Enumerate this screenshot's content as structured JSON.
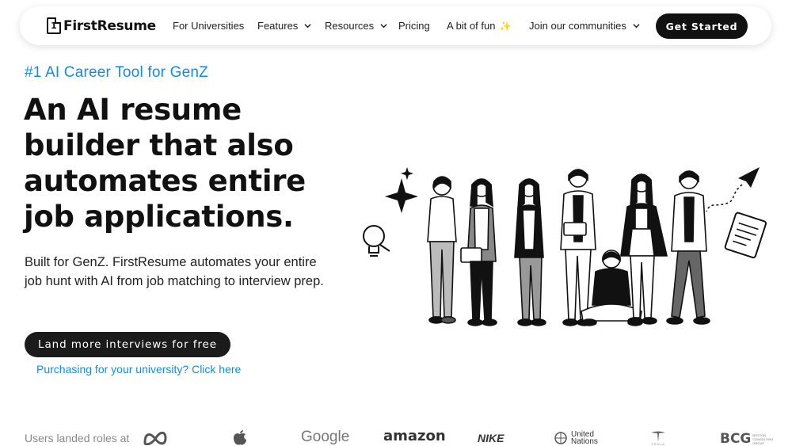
{
  "nav": {
    "logo_text": "FirstResume",
    "logo_mark": "1",
    "items": [
      {
        "label": "For Universities",
        "dropdown": false
      },
      {
        "label": "Features",
        "dropdown": true
      },
      {
        "label": "Resources",
        "dropdown": true
      },
      {
        "label": "Pricing",
        "dropdown": false
      },
      {
        "label": "A bit of fun",
        "dropdown": false,
        "icon": "sparkle-icon"
      },
      {
        "label": "Join our communities",
        "dropdown": true
      }
    ],
    "cta_label": "Get Started"
  },
  "hero": {
    "tagline": "#1 AI Career Tool for GenZ",
    "headline": "An AI resume builder that also automates entire job applications.",
    "subtext": "Built for GenZ. FirstResume automates your entire job hunt with AI from job matching to interview prep.",
    "cta_label": "Land more interviews for free",
    "university_link": "Purchasing for your university? Click here"
  },
  "logos": {
    "label": "Users landed roles at",
    "brands": [
      {
        "name": "meta-logo"
      },
      {
        "name": "apple-logo"
      },
      {
        "name": "google-logo",
        "text": "Google"
      },
      {
        "name": "amazon-logo",
        "text": "amazon"
      },
      {
        "name": "nike-logo",
        "text": "NIKE"
      },
      {
        "name": "united-nations-logo",
        "text": "United Nations"
      },
      {
        "name": "tesla-logo",
        "text": "TESLA"
      },
      {
        "name": "bcg-logo",
        "text": "BCG",
        "subtext": "BOSTON CONSULTING GROUP"
      }
    ]
  },
  "colors": {
    "accent_blue": "#1a8ad6",
    "button_dark": "#111111",
    "sparkle": "#f5a623"
  }
}
